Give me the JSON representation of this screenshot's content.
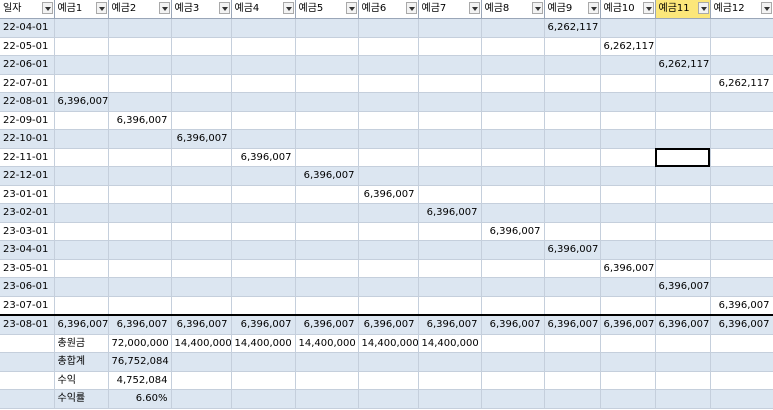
{
  "headers": [
    "일자",
    "예금1",
    "예금2",
    "예금3",
    "예금4",
    "예금5",
    "예금6",
    "예금7",
    "예금8",
    "예금9",
    "예금10",
    "예금11",
    "예금12"
  ],
  "highlight_header": 11,
  "rows": [
    {
      "date": "22-04-01",
      "col": 9,
      "value": "6,262,117"
    },
    {
      "date": "22-05-01",
      "col": 10,
      "value": "6,262,117"
    },
    {
      "date": "22-06-01",
      "col": 11,
      "value": "6,262,117"
    },
    {
      "date": "22-07-01",
      "col": 12,
      "value": "6,262,117"
    },
    {
      "date": "22-08-01",
      "col": 1,
      "value": "6,396,007"
    },
    {
      "date": "22-09-01",
      "col": 2,
      "value": "6,396,007"
    },
    {
      "date": "22-10-01",
      "col": 3,
      "value": "6,396,007"
    },
    {
      "date": "22-11-01",
      "col": 4,
      "value": "6,396,007"
    },
    {
      "date": "22-12-01",
      "col": 5,
      "value": "6,396,007"
    },
    {
      "date": "23-01-01",
      "col": 6,
      "value": "6,396,007"
    },
    {
      "date": "23-02-01",
      "col": 7,
      "value": "6,396,007"
    },
    {
      "date": "23-03-01",
      "col": 8,
      "value": "6,396,007"
    },
    {
      "date": "23-04-01",
      "col": 9,
      "value": "6,396,007"
    },
    {
      "date": "23-05-01",
      "col": 10,
      "value": "6,396,007"
    },
    {
      "date": "23-06-01",
      "col": 11,
      "value": "6,396,007"
    },
    {
      "date": "23-07-01",
      "col": 12,
      "value": "6,396,007"
    }
  ],
  "total_row": {
    "date": "23-08-01",
    "values": [
      "6,396,007",
      "6,396,007",
      "6,396,007",
      "6,396,007",
      "6,396,007",
      "6,396,007",
      "6,396,007",
      "6,396,007",
      "6,396,007",
      "6,396,007",
      "6,396,007",
      "6,396,007"
    ]
  },
  "summary": {
    "principal": {
      "label": "총원금",
      "values": [
        "72,000,000",
        "14,400,000",
        "14,400,000",
        "14,400,000",
        "14,400,000",
        "14,400,000"
      ]
    },
    "total": {
      "label": "총합계",
      "value": "76,752,084"
    },
    "profit": {
      "label": "수익",
      "value": "4,752,084"
    },
    "rate": {
      "label": "수익률",
      "value": "6.60%"
    }
  },
  "selected_cell": {
    "row": 7,
    "col": 11
  }
}
